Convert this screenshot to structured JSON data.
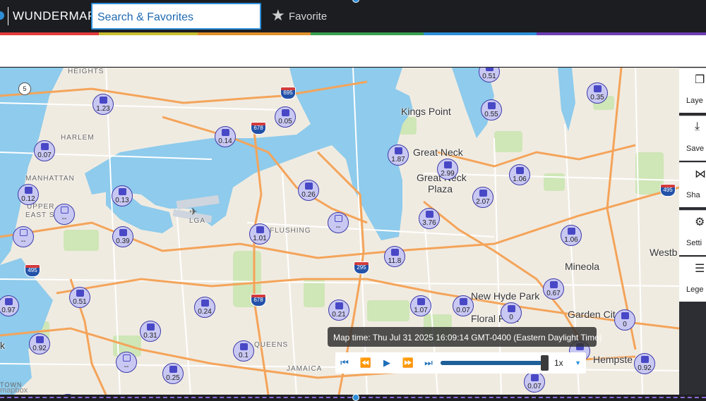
{
  "header": {
    "brand": "WUNDERMAP",
    "search_value": "Search & Favorites",
    "favorite_label": "Favorite"
  },
  "map": {
    "places": [
      {
        "label": "Kings Point",
        "small": false
      },
      {
        "label": "Great Neck",
        "small": false
      },
      {
        "label": "Great Neck",
        "small": false
      },
      {
        "label": "Plaza",
        "small": false
      },
      {
        "label": "New Hyde Park",
        "small": false
      },
      {
        "label": "Floral Park",
        "small": false
      },
      {
        "label": "Mineola",
        "small": false
      },
      {
        "label": "Garden Cit",
        "small": false
      },
      {
        "label": "Hempste",
        "small": false
      },
      {
        "label": "Westb",
        "small": false
      },
      {
        "label": "HEIGHTS",
        "small": true
      },
      {
        "label": "HARLEM",
        "small": true
      },
      {
        "label": "MANHATTAN",
        "small": true
      },
      {
        "label": "UPPER",
        "small": true
      },
      {
        "label": "EAST SI",
        "small": true
      },
      {
        "label": "FLUSHING",
        "small": true
      },
      {
        "label": "QUEENS",
        "small": true
      },
      {
        "label": "JAMAICA",
        "small": true
      },
      {
        "label": "LGA",
        "small": true
      },
      {
        "label": "k",
        "small": false
      }
    ],
    "stations": [
      "1.23",
      "0.07",
      "0.12",
      "--",
      "--",
      "0.39",
      "0.13",
      "0.14",
      "0.05",
      "0.26",
      "--",
      "1.01",
      "0.51",
      "0.55",
      "0.35",
      "1.87",
      "2.99",
      "1.06",
      "2.07",
      "3.76",
      "1.06",
      "11.8",
      "0.67",
      "0.97",
      "0.51",
      "0.24",
      "0.31",
      "0.21",
      "1.07",
      "0.07",
      "0",
      "0",
      "0.92",
      "--",
      "0.1",
      "0.25",
      "--",
      "0.68",
      "0.92",
      "0.07"
    ],
    "shields": [
      "695",
      "678",
      "495",
      "295",
      "678",
      "495"
    ],
    "town_label": "TOWN",
    "attribution": "mapbox"
  },
  "map_time": "Map time: Thu Jul 31 2025 16:09:14 GMT-0400 (Eastern Daylight Time)",
  "playback": {
    "speed": "1x",
    "progress": 0.95,
    "icons": [
      "skip-start-icon",
      "rewind-icon",
      "play-icon",
      "fast-forward-icon",
      "skip-end-icon"
    ]
  },
  "right_panel": [
    {
      "label": "Laye",
      "icon": "layers-icon"
    },
    {
      "label": "Save",
      "icon": "download-icon"
    },
    {
      "label": "Sha",
      "icon": "share-icon"
    },
    {
      "label": "Setti",
      "icon": "gear-icon"
    },
    {
      "label": "Lege",
      "icon": "list-icon"
    }
  ]
}
